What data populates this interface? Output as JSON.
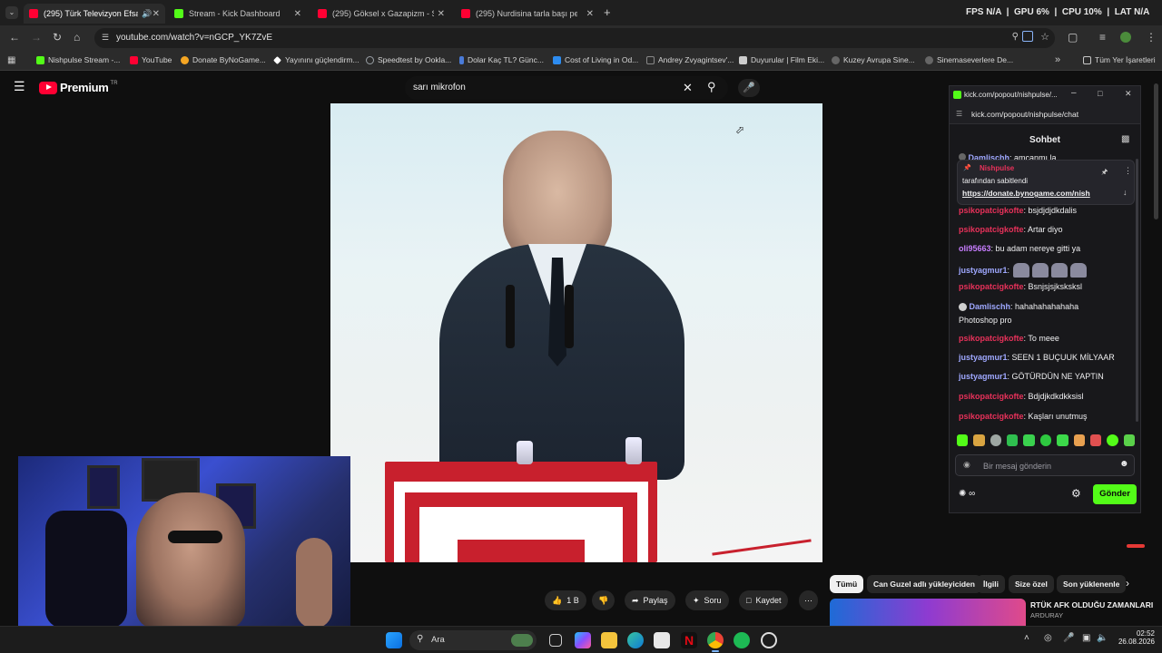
{
  "browser": {
    "tabs": [
      {
        "label": "(295) Türk Televizyon Efsan",
        "color": "#ff0033"
      },
      {
        "label": "Stream - Kick Dashboard",
        "color": "#53fc18"
      },
      {
        "label": "(295) Göksel x Gazapizm - Sen",
        "color": "#ff0033"
      },
      {
        "label": "(295) Nurdisina tarla başı peris",
        "color": "#ff0033"
      }
    ],
    "new_tab": "+",
    "stats": {
      "fps_label": "FPS",
      "fps_value": "N/A",
      "gpu_label": "GPU",
      "gpu_value": "6%",
      "cpu_label": "CPU",
      "cpu_value": "10%",
      "lat_label": "LAT",
      "lat_value": "N/A"
    },
    "url": "youtube.com/watch?v=nGCP_YK7ZvE"
  },
  "bookmarks": [
    {
      "label": "Nishpulse Stream -...",
      "color": "#53fc18"
    },
    {
      "label": "YouTube",
      "color": "#ff0033"
    },
    {
      "label": "Donate ByNoGame...",
      "color": "#f5a623"
    },
    {
      "label": "Yayınını güçlendirm...",
      "color": "#ffffff"
    },
    {
      "label": "Speedtest by Ookla...",
      "color": "#9aa0a6"
    },
    {
      "label": "Dolar Kaç TL? Günc...",
      "color": "#4a7bd8"
    },
    {
      "label": "Cost of Living in Od...",
      "color": "#2d8cf0"
    },
    {
      "label": "Andrey Zvyagintsev'...",
      "color": "#888888"
    },
    {
      "label": "Duyurular | Film Eki...",
      "color": "#cccccc"
    },
    {
      "label": "Kuzey Avrupa Sine...",
      "color": "#666666"
    },
    {
      "label": "Sinemaseverlere De...",
      "color": "#666666"
    }
  ],
  "bookmarks_more": "»",
  "bookmarks_all": "Tüm Yer İşaretleri",
  "youtube": {
    "logo_text": "Premium",
    "logo_sup": "TR",
    "search_query": "sarı mikrofon",
    "actions": {
      "like_count": "1 B",
      "share": "Paylaş",
      "ask": "Soru",
      "save": "Kaydet"
    },
    "chips": [
      "Tümü",
      "Can Guzel adlı yükleyiciden",
      "İlgili",
      "Size özel",
      "Son yüklenenle"
    ],
    "rec_title": "RTÜK AFK OLDUĞU ZAMANLARI",
    "rec_channel": "ARDURAY"
  },
  "chat": {
    "window_url_title": "kick.com/popout/nishpulse/...",
    "window_url": "kick.com/popout/nishpulse/chat",
    "header": "Sohbet",
    "pinned": {
      "top_user": "Damlischh",
      "top_text": ": amcanmı la",
      "pin_user": "Nishpulse",
      "pin_by": "tarafından sabitlendi",
      "pin_link": "https://donate.bynogame.com/nish"
    },
    "partial_line": {
      "user": "psikopatcigkofte",
      "text": ": bsjdjdjdkdalis"
    },
    "messages": [
      {
        "user": "psikopatcigkofte",
        "text": ": Artar diyo",
        "color": "#e8315a"
      },
      {
        "user": "oli95663",
        "text": ": bu adam nereye gitti ya",
        "color": "#c77dff"
      },
      {
        "user": "justyagmur1",
        "text": ":",
        "color": "#9fa8ff"
      },
      {
        "user": "psikopatcigkofte",
        "text": ": Bsnjsjsjksksksl",
        "color": "#e8315a"
      },
      {
        "user": "Damlischh",
        "text": ": hahahahahahaha",
        "color": "#9fa8ff"
      },
      {
        "user": "",
        "text": "Photoshop pro",
        "color": "#efeff1"
      },
      {
        "user": "psikopatcigkofte",
        "text": ": To meee",
        "color": "#e8315a"
      },
      {
        "user": "justyagmur1",
        "text": ": SEEN 1 BUÇUUK MİLYAAR",
        "color": "#9fa8ff"
      },
      {
        "user": "justyagmur1",
        "text": ": GÖTÜRDÜN NE YAPTIN",
        "color": "#9fa8ff"
      },
      {
        "user": "psikopatcigkofte",
        "text": ": Bdjdjkdkdkksisl",
        "color": "#e8315a"
      },
      {
        "user": "psikopatcigkofte",
        "text": ": Kaşları unutmuş",
        "color": "#e8315a"
      }
    ],
    "input_placeholder": "Bir mesaj gönderin",
    "send": "Gönder",
    "accent": "#53fc18"
  },
  "taskbar": {
    "search": "Ara",
    "time": "02:52",
    "date": "26.08.2026"
  }
}
